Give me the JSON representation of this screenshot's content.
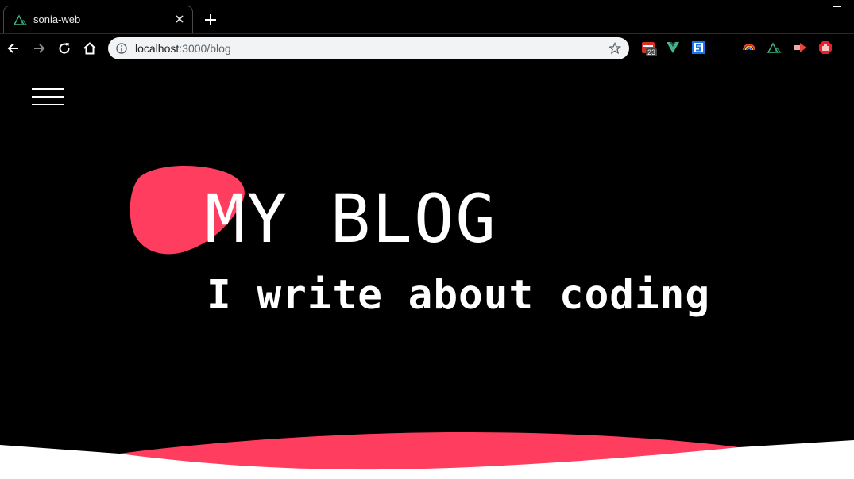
{
  "browser": {
    "tab": {
      "title": "sonia-web",
      "favicon": "nuxt-icon"
    },
    "new_tab_icon": "plus-icon",
    "address_bar": {
      "host": "localhost",
      "path": ":3000/blog"
    },
    "extensions": [
      {
        "name": "calendar-extension-icon",
        "badge": "23"
      },
      {
        "name": "vue-devtools-icon"
      },
      {
        "name": "s-extension-icon"
      },
      {
        "name": "rainbow-extension-icon"
      },
      {
        "name": "nuxt-extension-icon"
      },
      {
        "name": "arrow-extension-icon"
      },
      {
        "name": "adblock-icon"
      }
    ]
  },
  "page": {
    "menu_icon": "hamburger-icon",
    "hero": {
      "title": "MY BLOG",
      "subtitle": "I write about coding"
    }
  },
  "colors": {
    "accent": "#ff3d5e",
    "background": "#000000",
    "text": "#ffffff",
    "nuxt_green": "#41b883"
  }
}
